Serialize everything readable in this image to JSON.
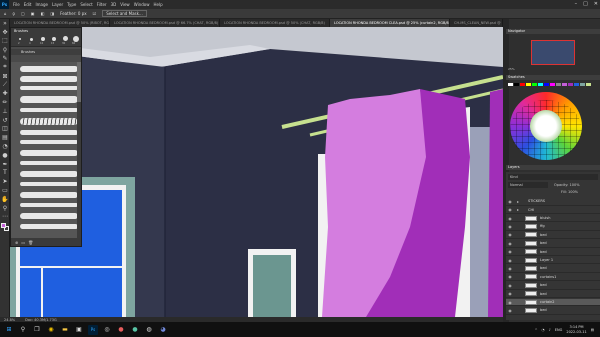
{
  "app": {
    "logo": "Ps"
  },
  "menu": [
    "File",
    "Edit",
    "Image",
    "Layer",
    "Type",
    "Select",
    "Filter",
    "3D",
    "View",
    "Window",
    "Help"
  ],
  "options": {
    "feather": "Feather: 0 px",
    "select_mask": "Select and Mask..."
  },
  "tabs": [
    "LOCATION RHONDA BEDROOM.psd @ 50% (RIBOT, RGB/8)",
    "LOCATION RHONDA BEDROOM.psd @ 66.7% (CHAT, RGB/8)",
    "LOCATION RHONDA BEDROOM.psd @ 50% (CHAT, RGB/8)",
    "LOCATION RHONDA BEDROOM CLEA.psd @ 25% (curtain2, RGB/8)",
    "CH-MS_CLEAN_NEW.psd @ 50% (frame, RGB/8)"
  ],
  "active_tab": 3,
  "brushes_panel": {
    "title": "Brushes",
    "sizes": [
      "2",
      "4",
      "10",
      "15",
      "30",
      "60"
    ],
    "folder": "Brushes",
    "footer_icons": [
      "new-brush-icon",
      "folder-icon",
      "trash-icon"
    ]
  },
  "navigator": {
    "title": "Navigator",
    "zoom": "25%"
  },
  "swatches": {
    "title": "Swatches"
  },
  "layers_panel": {
    "title": "Layers",
    "kind": "Kind",
    "blend": "Normal",
    "opacity_label": "Opacity:",
    "opacity": "100%",
    "fill_label": "Fill:",
    "fill": "100%",
    "rows": [
      {
        "name": "STICKERS",
        "group": true,
        "selected": false
      },
      {
        "name": "CHI",
        "group": true,
        "selected": false
      },
      {
        "name": "bluish",
        "group": false,
        "selected": false
      },
      {
        "name": "ffg",
        "group": false,
        "selected": false
      },
      {
        "name": "bed",
        "group": false,
        "selected": false
      },
      {
        "name": "bed",
        "group": false,
        "selected": false
      },
      {
        "name": "bed",
        "group": false,
        "selected": false
      },
      {
        "name": "Layer 1",
        "group": false,
        "selected": false
      },
      {
        "name": "bed",
        "group": false,
        "selected": false
      },
      {
        "name": "curtains1",
        "group": false,
        "selected": false
      },
      {
        "name": "bed",
        "group": false,
        "selected": false
      },
      {
        "name": "bed",
        "group": false,
        "selected": false
      },
      {
        "name": "curtain2",
        "group": false,
        "selected": true
      },
      {
        "name": "bed",
        "group": false,
        "selected": false
      }
    ]
  },
  "status": {
    "zoom": "24.8%",
    "doc": "Doc: 40.3M/1.73G"
  },
  "taskbar": {
    "icons": [
      "windows-icon",
      "search-icon",
      "taskview-icon",
      "chrome-icon",
      "folder-icon",
      "explorer-icon",
      "photoshop-icon",
      "steam-icon",
      "app-icon",
      "app-icon-2",
      "obs-icon",
      "discord-icon"
    ],
    "lang": "ENG",
    "time": "3:14 PM",
    "date": "2022-03-11"
  },
  "colors": {
    "wall": "#2c2f45",
    "wall_dark": "#25283a",
    "ceiling": "#c5c8d0",
    "curtain_light": "#d47ddf",
    "curtain_dark": "#a12eb8",
    "rod": "#c6e08f",
    "door": "#1f5fe0",
    "window_frame": "#7ea5a0",
    "white": "#f2f2f2",
    "gray_panel": "#9aa0b8"
  }
}
